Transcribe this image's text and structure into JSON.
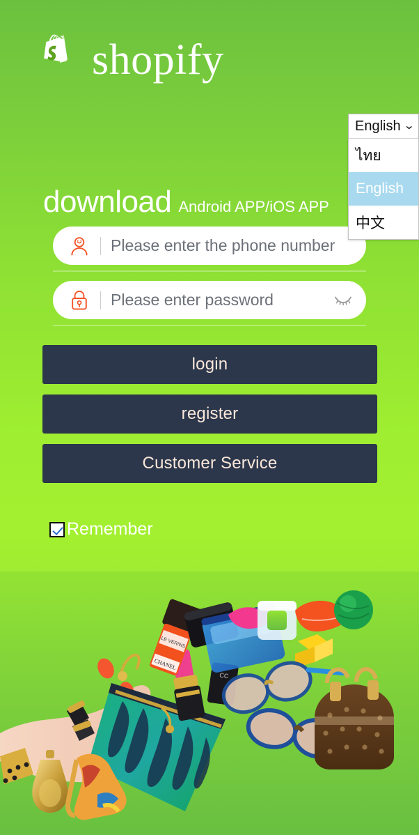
{
  "brand": {
    "name": "shopify",
    "logo_icon": "shopify-bag-icon",
    "logo_color": "#ffffff"
  },
  "theme": {
    "background_top": "#6bc13e",
    "background_mid": "#a3f030",
    "background_bottom": "#6bc240",
    "button_bg": "#2c374b",
    "button_text": "#fbe8db",
    "field_bg": "#ffffff",
    "field_icon_color": "#f4552a",
    "dropdown_highlight": "#a8d9ef"
  },
  "language_selector": {
    "current": "English",
    "chevron_icon": "chevron-down-icon",
    "expanded": true,
    "options": [
      {
        "label": "ไทย",
        "selected": false
      },
      {
        "label": "English",
        "selected": true
      },
      {
        "label": "中文",
        "selected": false
      }
    ]
  },
  "headline": {
    "main": "download",
    "sub": "Android APP/iOS APP"
  },
  "form": {
    "phone": {
      "icon": "user-icon",
      "placeholder": "Please enter the phone number",
      "value": ""
    },
    "password": {
      "icon": "lock-icon",
      "placeholder": "Please enter password",
      "value": "",
      "toggle_icon": "eye-off-icon"
    },
    "remember": {
      "label": "Remember",
      "checked": true
    }
  },
  "actions": {
    "login": "login",
    "register": "register",
    "customer_service": "Customer Service"
  },
  "hero": {
    "alt": "fashion accessories collage with hand, clutch bag, sunglasses, handbag, lipstick, nail polish, heel shoe and perfume"
  }
}
